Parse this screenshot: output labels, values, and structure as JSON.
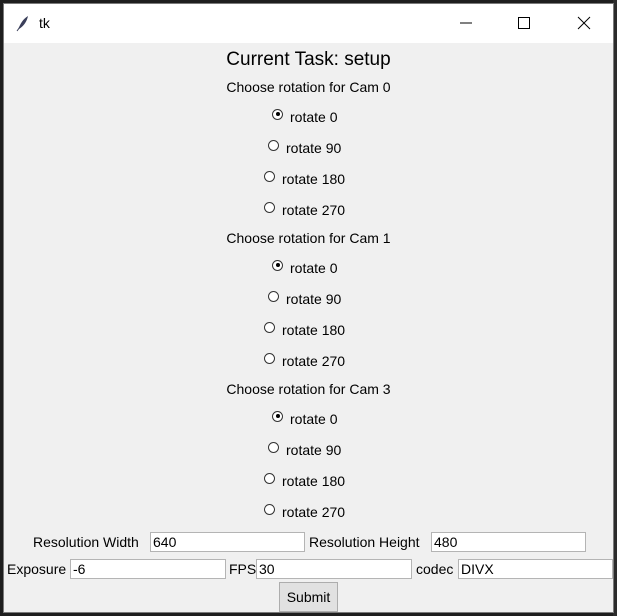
{
  "window": {
    "title": "tk"
  },
  "task_title": "Current Task: setup",
  "cams": [
    {
      "label": "Choose rotation for Cam 0",
      "options": [
        "rotate 0",
        "rotate 90",
        "rotate 180",
        "rotate 270"
      ],
      "selected": "rotate 0"
    },
    {
      "label": "Choose rotation for Cam 1",
      "options": [
        "rotate 0",
        "rotate 90",
        "rotate 180",
        "rotate 270"
      ],
      "selected": "rotate 0"
    },
    {
      "label": "Choose rotation for Cam 3",
      "options": [
        "rotate 0",
        "rotate 90",
        "rotate 180",
        "rotate 270"
      ],
      "selected": "rotate 0"
    }
  ],
  "settings": {
    "res_width_label": "Resolution Width",
    "res_width_value": "640",
    "res_height_label": "Resolution Height",
    "res_height_value": "480",
    "exposure_label": "Exposure",
    "exposure_value": "-6",
    "fps_label": "FPS",
    "fps_value": "30",
    "codec_label": "codec",
    "codec_value": "DIVX"
  },
  "submit_label": "Submit",
  "icons": {
    "app": "feather-icon",
    "minimize": "minimize-icon",
    "maximize": "maximize-icon",
    "close": "close-icon"
  }
}
